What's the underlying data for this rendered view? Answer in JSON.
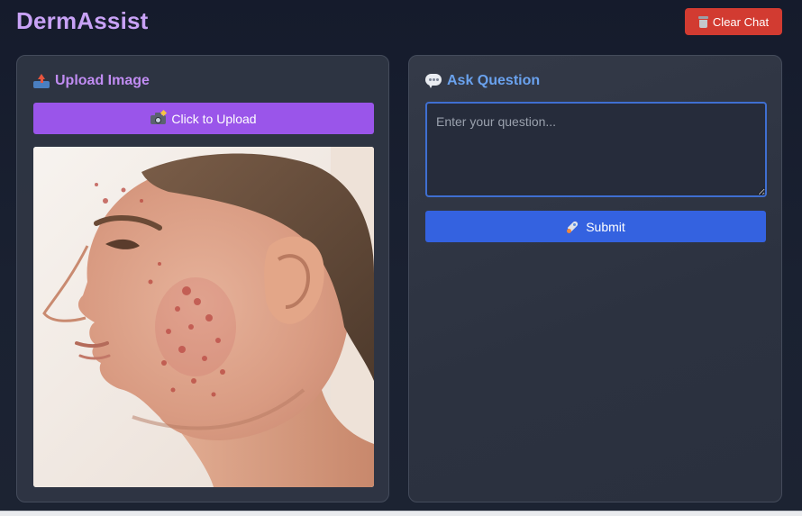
{
  "header": {
    "app_title": "DermAssist",
    "clear_button_label": "Clear Chat",
    "clear_button_icon": "trash-icon"
  },
  "upload_panel": {
    "heading": "Upload Image",
    "heading_icon": "upload-tray-icon",
    "upload_button_label": "Click to Upload",
    "upload_button_icon": "camera-icon",
    "image_description": "profile-photo"
  },
  "question_panel": {
    "heading": "Ask Question",
    "heading_icon": "speech-bubble-icon",
    "question_input_value": "",
    "question_input_placeholder": "Enter your question...",
    "submit_button_label": "Submit",
    "submit_button_icon": "rocket-icon"
  },
  "colors": {
    "background": "#151b2c",
    "title_purple": "#c8a2f6",
    "clear_button_red": "#d23b31",
    "upload_button_purple": "#9a55ea",
    "submit_button_blue": "#3462e0",
    "ask_heading_blue": "#6aa2ee",
    "input_focus_border": "#3f6fd1"
  }
}
